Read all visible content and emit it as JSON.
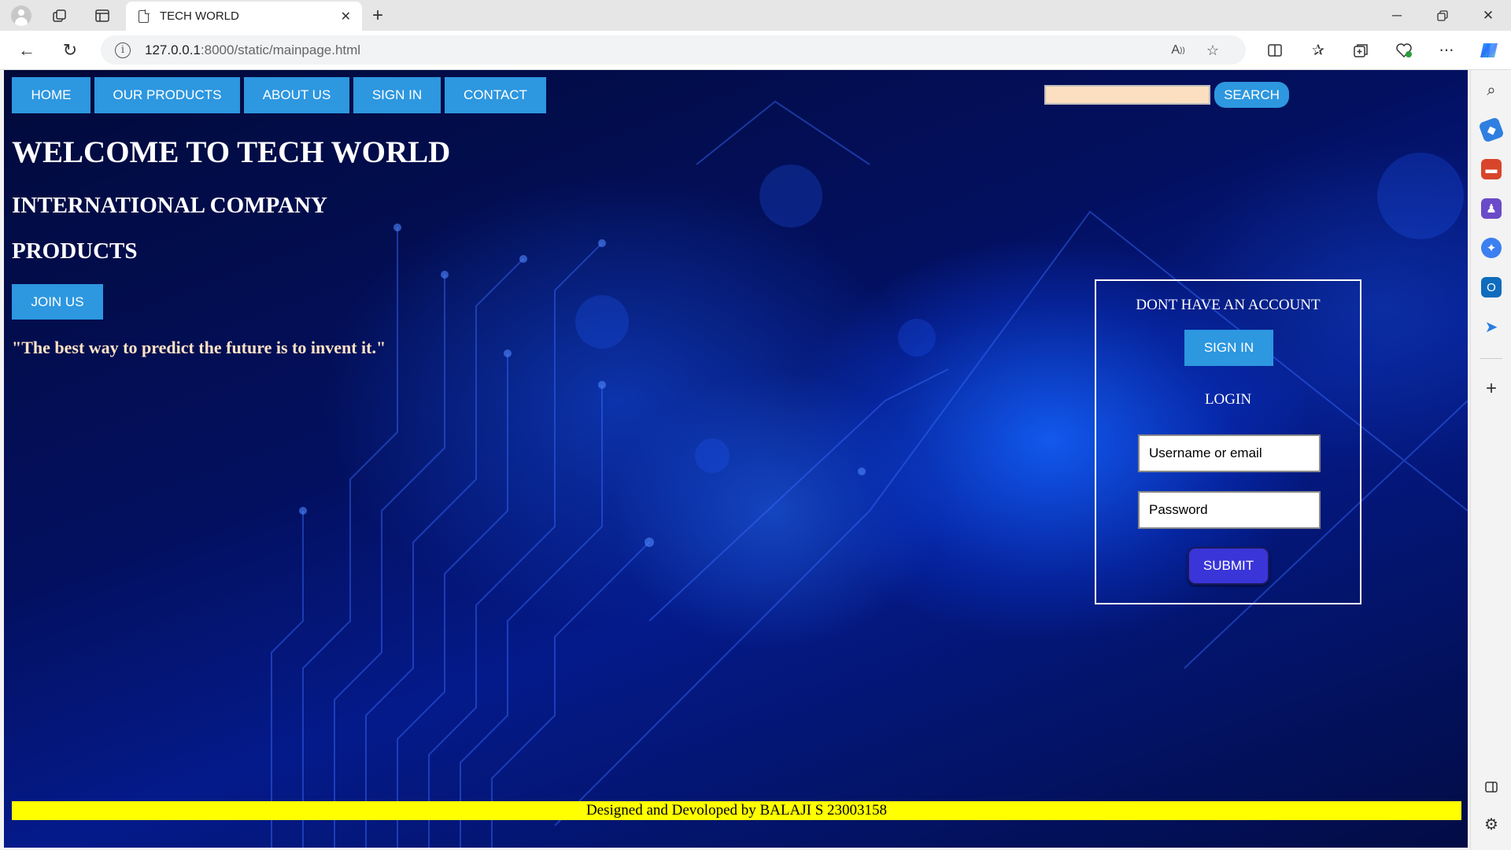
{
  "browser": {
    "tab_title": "TECH WORLD",
    "url_host": "127.0.0.1",
    "url_rest": ":8000/static/mainpage.html",
    "icons": [
      "profile-icon",
      "workspaces-icon",
      "tab-actions-icon",
      "document-icon",
      "close-icon",
      "new-tab-icon",
      "back-icon",
      "refresh-icon",
      "info-icon",
      "read-aloud-icon",
      "favorite-star-icon",
      "split-screen-icon",
      "favorites-icon",
      "collections-icon",
      "browser-essentials-icon",
      "more-icon",
      "copilot-icon"
    ]
  },
  "sidebar": {
    "icons": [
      "search-icon",
      "shopping-tag-icon",
      "tools-icon",
      "games-icon",
      "microsoft365-icon",
      "outlook-icon",
      "send-icon",
      "add-icon",
      "panel-icon",
      "settings-icon"
    ]
  },
  "page": {
    "nav": [
      "HOME",
      "OUR PRODUCTS",
      "ABOUT US",
      "SIGN IN",
      "CONTACT"
    ],
    "search_button": "SEARCH",
    "search_value": "",
    "heading": "WELCOME TO TECH WORLD",
    "subheading1": "INTERNATIONAL COMPANY",
    "subheading2": "PRODUCTS",
    "join_button": "JOIN US",
    "quote": "\"The best way to predict the future is to invent it.\"",
    "panel": {
      "question": "DONT HAVE AN ACCOUNT",
      "signin_button": "SIGN IN",
      "login_title": "LOGIN",
      "username_placeholder": "Username or email",
      "password_placeholder": "Password",
      "submit_button": "SUBMIT"
    },
    "footer": "Designed and Devoloped by BALAJI S 23003158"
  },
  "colors": {
    "nav_button": "#2d97e0",
    "submit_button": "#3a35d8",
    "footer_bg": "#ffff00",
    "quote_text": "#fde3c4",
    "search_input_bg": "#fcdfc0"
  }
}
